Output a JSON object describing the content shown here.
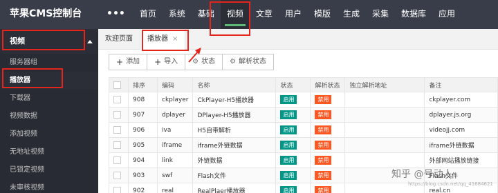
{
  "app": {
    "title": "苹果CMS控制台"
  },
  "topnav": {
    "menu_icon": "•••",
    "items": [
      {
        "label": "首页",
        "active": false
      },
      {
        "label": "系统",
        "active": false
      },
      {
        "label": "基础",
        "active": false
      },
      {
        "label": "视频",
        "active": true
      },
      {
        "label": "文章",
        "active": false
      },
      {
        "label": "用户",
        "active": false
      },
      {
        "label": "模版",
        "active": false
      },
      {
        "label": "生成",
        "active": false
      },
      {
        "label": "采集",
        "active": false
      },
      {
        "label": "数据库",
        "active": false
      },
      {
        "label": "应用",
        "active": false
      }
    ]
  },
  "sidebar": {
    "header": "视频",
    "items": [
      {
        "label": "服务器组",
        "active": false
      },
      {
        "label": "播放器",
        "active": true
      },
      {
        "label": "下载器",
        "active": false
      },
      {
        "label": "视频数据",
        "active": false
      },
      {
        "label": "添加视频",
        "active": false
      },
      {
        "label": "无地址视频",
        "active": false
      },
      {
        "label": "已锁定视频",
        "active": false
      },
      {
        "label": "未审核视频",
        "active": false
      }
    ]
  },
  "tabs": [
    {
      "label": "欢迎页面",
      "active": false,
      "closable": false
    },
    {
      "label": "播放器",
      "active": true,
      "closable": true,
      "close_icon": "×"
    }
  ],
  "toolbar": {
    "add": "添加",
    "import": "导入",
    "status": "状态",
    "parse_status": "解析状态"
  },
  "table": {
    "headers": [
      "排序",
      "编码",
      "名称",
      "状态",
      "解析状态",
      "独立解析地址",
      "备注"
    ],
    "rows": [
      {
        "sort": "908",
        "code": "ckplayer",
        "name": "CkPlayer-H5播放器",
        "status": "启用",
        "parse": "禁用",
        "addr": "",
        "note": "ckplayer.com"
      },
      {
        "sort": "907",
        "code": "dplayer",
        "name": "DPlayer-H5播放器",
        "status": "启用",
        "parse": "禁用",
        "addr": "",
        "note": "dplayer.js.org"
      },
      {
        "sort": "906",
        "code": "iva",
        "name": "H5自带解析",
        "status": "启用",
        "parse": "禁用",
        "addr": "",
        "note": "videojj.com"
      },
      {
        "sort": "905",
        "code": "iframe",
        "name": "iframe外链数据",
        "status": "启用",
        "parse": "禁用",
        "addr": "",
        "note": "iframe外链数据"
      },
      {
        "sort": "904",
        "code": "link",
        "name": "外链数据",
        "status": "启用",
        "parse": "禁用",
        "addr": "",
        "note": "外部网站播放链接"
      },
      {
        "sort": "903",
        "code": "swf",
        "name": "Flash文件",
        "status": "启用",
        "parse": "禁用",
        "addr": "",
        "note": "Flash文件"
      },
      {
        "sort": "902",
        "code": "real",
        "name": "RealPlaer播放器",
        "status": "启用",
        "parse": "禁用",
        "addr": "",
        "note": "real.cn"
      }
    ]
  },
  "watermark": {
    "text": "知乎 @号动人",
    "sub": "https://blog.csdn.net/qq_41684621"
  },
  "colors": {
    "topbar": "#393d49",
    "active_underline": "#5fb878",
    "enabled_badge": "#009688",
    "disabled_badge": "#ff5722",
    "highlight": "#e5251b"
  }
}
